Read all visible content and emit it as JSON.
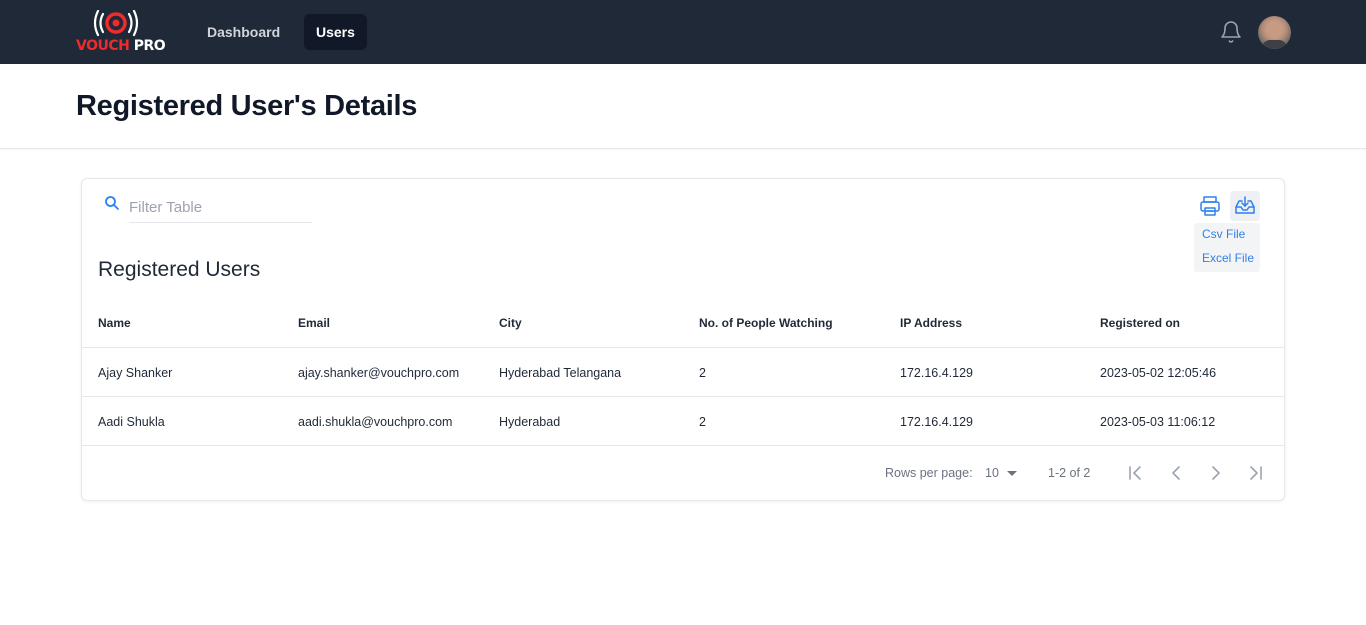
{
  "brand": {
    "logo_word1": "VOUCH",
    "logo_word2": "PRO",
    "accent_color": "#ef2b2d"
  },
  "nav": {
    "items": [
      {
        "label": "Dashboard",
        "active": false
      },
      {
        "label": "Users",
        "active": true
      }
    ],
    "icons": {
      "notifications": "bell-icon",
      "profile": "avatar"
    }
  },
  "page": {
    "title": "Registered User's Details"
  },
  "table": {
    "title": "Registered Users",
    "search_placeholder": "Filter Table",
    "export": {
      "csv_label": "Csv File",
      "excel_label": "Excel File"
    },
    "columns": [
      "Name",
      "Email",
      "City",
      "No. of People Watching",
      "IP Address",
      "Registered on"
    ],
    "rows": [
      [
        "Ajay Shanker",
        "ajay.shanker@vouchpro.com",
        "Hyderabad Telangana",
        "2",
        "172.16.4.129",
        "2023-05-02 12:05:46"
      ],
      [
        "Aadi Shukla",
        "aadi.shukla@vouchpro.com",
        "Hyderabad",
        "2",
        "172.16.4.129",
        "2023-05-03 11:06:12"
      ]
    ],
    "pagination": {
      "rows_per_page_label": "Rows per page:",
      "rows_per_page": "10",
      "range": "1-2 of 2"
    }
  }
}
